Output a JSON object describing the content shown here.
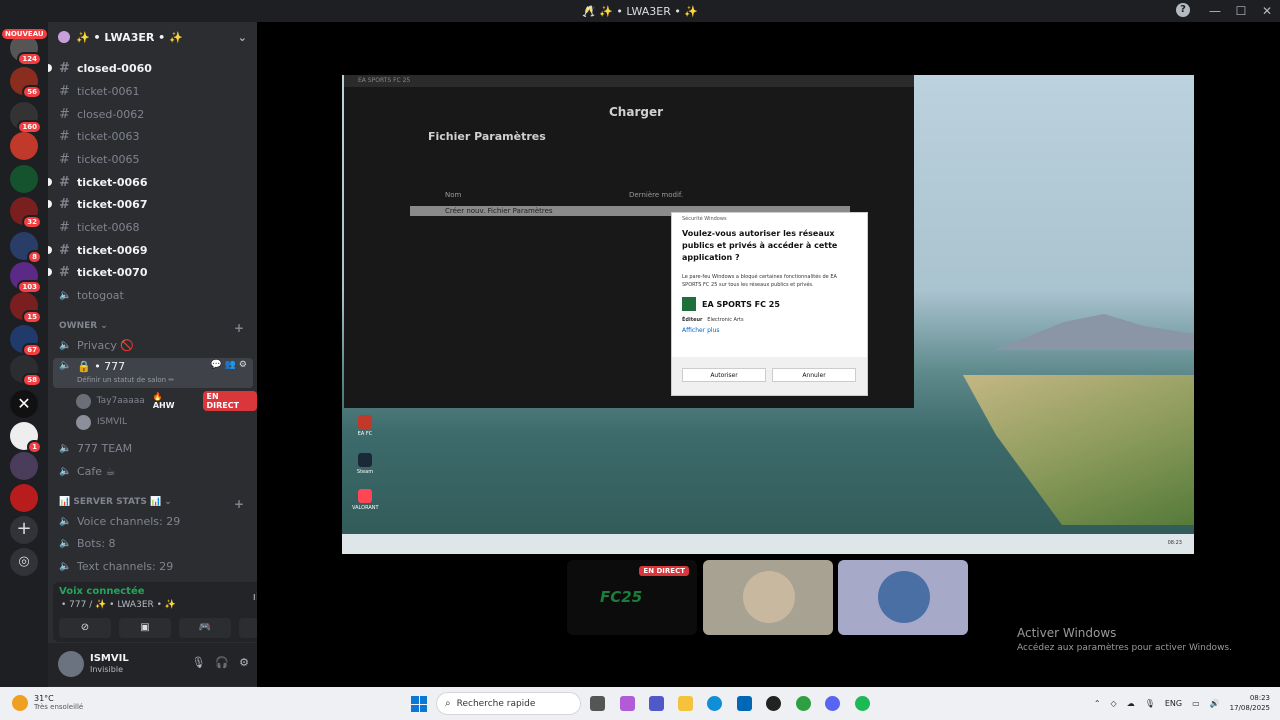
{
  "window": {
    "title": "🥂 ✨ • LWA3ER • ✨",
    "help": "?",
    "controls": [
      "—",
      "☐",
      "✕"
    ]
  },
  "rail": {
    "nouveau": "NOUVEAU",
    "badges": [
      "124",
      "56",
      "160",
      "32",
      "8",
      "103",
      "15",
      "67",
      "58",
      "1"
    ]
  },
  "guild": {
    "name": "✨ • LWA3ER • ✨",
    "chevron": "⌄"
  },
  "channels": [
    {
      "name": "closed-0060",
      "unread": true
    },
    {
      "name": "ticket-0061",
      "unread": false
    },
    {
      "name": "closed-0062",
      "unread": false
    },
    {
      "name": "ticket-0063",
      "unread": false
    },
    {
      "name": "ticket-0065",
      "unread": false
    },
    {
      "name": "ticket-0066",
      "unread": true
    },
    {
      "name": "ticket-0067",
      "unread": true
    },
    {
      "name": "ticket-0068",
      "unread": false
    },
    {
      "name": "ticket-0069",
      "unread": true
    },
    {
      "name": "ticket-0070",
      "unread": true
    }
  ],
  "voice_top": "totogoat",
  "category_owner": "OWNER",
  "privacy": "Privacy 🚫",
  "active_voice": {
    "name": "🔒 • 777",
    "status_hint": "Définir un statut de salon ✏"
  },
  "members": [
    {
      "name": "Tay7aaaaa",
      "tag": "🔥 AHW",
      "live": "EN DIRECT"
    },
    {
      "name": "ISMVIL"
    }
  ],
  "more_voice": [
    "777 TEAM",
    "Cafe ☕"
  ],
  "category_stats": "📊 SERVER STATS 📊",
  "stats": [
    "Voice channels: 29",
    "Bots: 8",
    "Text channels: 29"
  ],
  "voice_panel": {
    "title": "Voix connectée",
    "sub": "• 777 / ✨ • LWA3ER • ✨"
  },
  "user": {
    "name": "ISMVIL",
    "status": "Invisible"
  },
  "stream": {
    "game_title_bar": "EA SPORTS FC 25",
    "heading": "Charger",
    "section": "Fichier Paramètres",
    "col_name": "Nom",
    "col_modified": "Dernière modif.",
    "row_new": "Créer nouv. Fichier Paramètres",
    "dialog": {
      "header": "Sécurité Windows",
      "title": "Voulez-vous autoriser les réseaux publics et privés à accéder à cette application ?",
      "desc": "Le pare-feu Windows a bloqué certaines fonctionnalités de EA SPORTS FC 25 sur tous les réseaux publics et privés.",
      "app": "EA SPORTS FC 25",
      "publisher_label": "Éditeur",
      "publisher": "Electronic Arts",
      "more": "Afficher plus",
      "allow": "Autoriser",
      "cancel": "Annuler"
    },
    "desktop_icons": [
      "EA FC",
      "Steam",
      "VALORANT"
    ],
    "inner_clock": "08:23"
  },
  "thumbs": {
    "live": "EN DIRECT",
    "game_logo": "FC25"
  },
  "activate": {
    "line1": "Activer Windows",
    "line2": "Accédez aux paramètres pour activer Windows."
  },
  "taskbar": {
    "temp": "31°C",
    "weather": "Très ensoleillé",
    "search": "Recherche rapide",
    "lang": "ENG",
    "time": "08:23",
    "date": "17/08/2025"
  }
}
